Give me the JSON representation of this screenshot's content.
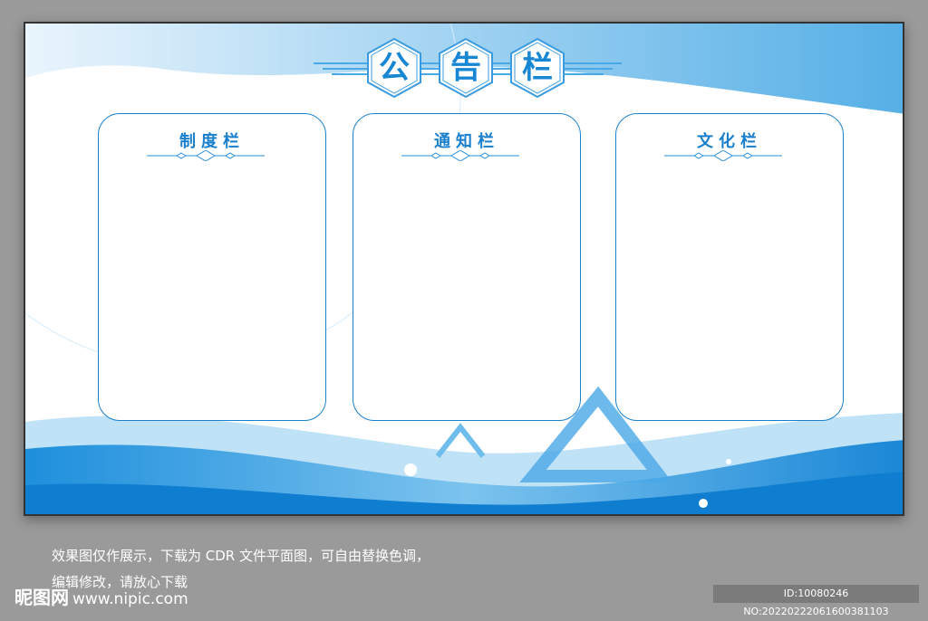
{
  "board": {
    "title_chars": [
      "公",
      "告",
      "栏"
    ],
    "panels": [
      {
        "title": "制度栏"
      },
      {
        "title": "通知栏"
      },
      {
        "title": "文化栏"
      }
    ]
  },
  "caption": {
    "line1": "效果图仅作展示，下载为 CDR 文件平面图，可自由替换色调，",
    "line2": "编辑修改，请放心下载"
  },
  "watermark": {
    "logo": "昵图网",
    "url": "www.nipic.com",
    "id": "ID:10080246 NO:20220222061600381103"
  },
  "colors": {
    "accent": "#1a7fcc",
    "background": "#9a9a9a"
  }
}
